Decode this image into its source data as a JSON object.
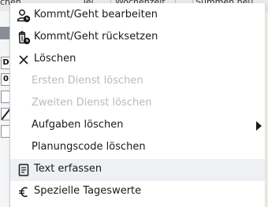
{
  "background": {
    "header_tabs": [
      "chen",
      "Tel",
      "Wochenzeit",
      "Summen heu"
    ],
    "row_markers": [
      "D",
      "0",
      "",
      ""
    ]
  },
  "menu": {
    "items": [
      {
        "label": "Kommt/Geht bearbeiten",
        "icon": "user-clock-icon",
        "enabled": true
      },
      {
        "label": "Kommt/Geht rücksetzen",
        "icon": "trash-clock-icon",
        "enabled": true
      },
      {
        "label": "Löschen",
        "icon": "close-icon",
        "enabled": true
      },
      {
        "label": "Ersten Dienst löschen",
        "icon": "",
        "enabled": false
      },
      {
        "label": "Zweiten Dienst löschen",
        "icon": "",
        "enabled": false
      },
      {
        "label": "Aufgaben löschen",
        "icon": "",
        "enabled": true,
        "submenu": true
      },
      {
        "label": "Planungscode löschen",
        "icon": "",
        "enabled": true
      },
      {
        "label": "Text erfassen",
        "icon": "document-icon",
        "enabled": true
      },
      {
        "label": "Spezielle Tageswerte",
        "icon": "euro-icon",
        "enabled": true
      }
    ]
  }
}
